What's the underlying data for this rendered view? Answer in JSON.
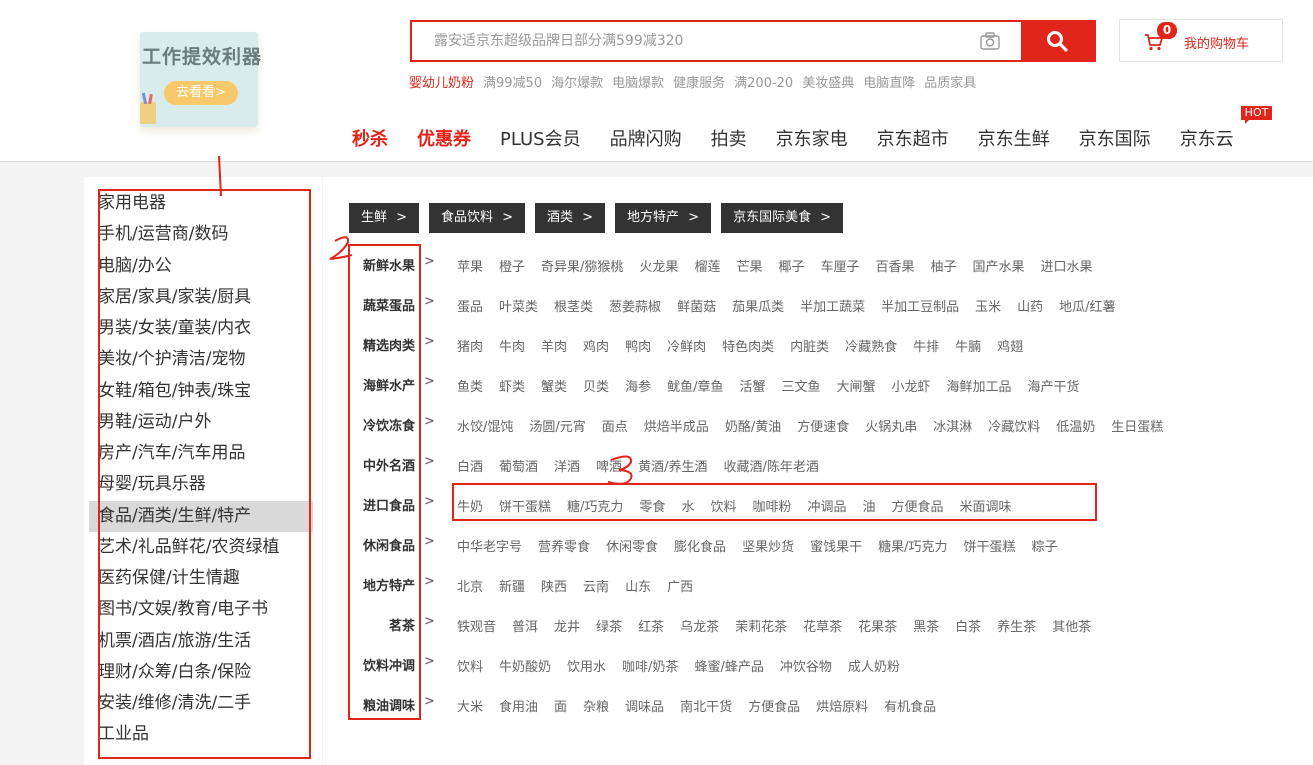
{
  "promo": {
    "title": "工作提效利器",
    "button": "去看看>"
  },
  "search": {
    "placeholder": "露安适京东超级品牌日部分满599减320"
  },
  "cart": {
    "count": "0",
    "label": "我的购物车"
  },
  "hotwords": [
    "婴幼儿奶粉",
    "满99减50",
    "海尔爆款",
    "电脑爆款",
    "健康服务",
    "满200-20",
    "美妆盛典",
    "电脑直降",
    "品质家具"
  ],
  "nav": {
    "items": [
      "秒杀",
      "优惠券",
      "PLUS会员",
      "品牌闪购",
      "拍卖",
      "京东家电",
      "京东超市",
      "京东生鲜",
      "京东国际",
      "京东云"
    ],
    "hot_badge": "HOT"
  },
  "categories": [
    "家用电器",
    "手机/运营商/数码",
    "电脑/办公",
    "家居/家具/家装/厨具",
    "男装/女装/童装/内衣",
    "美妆/个护清洁/宠物",
    "女鞋/箱包/钟表/珠宝",
    "男鞋/运动/户外",
    "房产/汽车/汽车用品",
    "母婴/玩具乐器",
    "食品/酒类/生鲜/特产",
    "艺术/礼品鲜花/农资绿植",
    "医药保健/计生情趣",
    "图书/文娱/教育/电子书",
    "机票/酒店/旅游/生活",
    "理财/众筹/白条/保险",
    "安装/维修/清洗/二手",
    "工业品"
  ],
  "active_category_index": 10,
  "channel_tabs": [
    "生鲜",
    "食品饮料",
    "酒类",
    "地方特产",
    "京东国际美食"
  ],
  "chevron_glyph": ">",
  "subcategories": [
    {
      "title": "新鲜水果",
      "items": [
        "苹果",
        "橙子",
        "奇异果/猕猴桃",
        "火龙果",
        "榴莲",
        "芒果",
        "椰子",
        "车厘子",
        "百香果",
        "柚子",
        "国产水果",
        "进口水果"
      ]
    },
    {
      "title": "蔬菜蛋品",
      "items": [
        "蛋品",
        "叶菜类",
        "根茎类",
        "葱姜蒜椒",
        "鲜菌菇",
        "茄果瓜类",
        "半加工蔬菜",
        "半加工豆制品",
        "玉米",
        "山药",
        "地瓜/红薯"
      ]
    },
    {
      "title": "精选肉类",
      "items": [
        "猪肉",
        "牛肉",
        "羊肉",
        "鸡肉",
        "鸭肉",
        "冷鲜肉",
        "特色肉类",
        "内脏类",
        "冷藏熟食",
        "牛排",
        "牛腩",
        "鸡翅"
      ]
    },
    {
      "title": "海鲜水产",
      "items": [
        "鱼类",
        "虾类",
        "蟹类",
        "贝类",
        "海参",
        "鱿鱼/章鱼",
        "活蟹",
        "三文鱼",
        "大闸蟹",
        "小龙虾",
        "海鲜加工品",
        "海产干货"
      ]
    },
    {
      "title": "冷饮冻食",
      "items": [
        "水饺/馄饨",
        "汤圆/元宵",
        "面点",
        "烘焙半成品",
        "奶酪/黄油",
        "方便速食",
        "火锅丸串",
        "冰淇淋",
        "冷藏饮料",
        "低温奶",
        "生日蛋糕"
      ]
    },
    {
      "title": "中外名酒",
      "items": [
        "白酒",
        "葡萄酒",
        "洋酒",
        "啤酒",
        "黄酒/养生酒",
        "收藏酒/陈年老酒"
      ]
    },
    {
      "title": "进口食品",
      "items": [
        "牛奶",
        "饼干蛋糕",
        "糖/巧克力",
        "零食",
        "水",
        "饮料",
        "咖啡粉",
        "冲调品",
        "油",
        "方便食品",
        "米面调味"
      ]
    },
    {
      "title": "休闲食品",
      "items": [
        "中华老字号",
        "营养零食",
        "休闲零食",
        "膨化食品",
        "坚果炒货",
        "蜜饯果干",
        "糖果/巧克力",
        "饼干蛋糕",
        "粽子"
      ]
    },
    {
      "title": "地方特产",
      "items": [
        "北京",
        "新疆",
        "陕西",
        "云南",
        "山东",
        "广西"
      ]
    },
    {
      "title": "茗茶",
      "items": [
        "铁观音",
        "普洱",
        "龙井",
        "绿茶",
        "红茶",
        "乌龙茶",
        "茉莉花茶",
        "花草茶",
        "花果茶",
        "黑茶",
        "白茶",
        "养生茶",
        "其他茶"
      ]
    },
    {
      "title": "饮料冲调",
      "items": [
        "饮料",
        "牛奶酸奶",
        "饮用水",
        "咖啡/奶茶",
        "蜂蜜/蜂产品",
        "冲饮谷物",
        "成人奶粉"
      ]
    },
    {
      "title": "粮油调味",
      "items": [
        "大米",
        "食用油",
        "面",
        "杂粮",
        "调味品",
        "南北干货",
        "方便食品",
        "烘焙原料",
        "有机食品"
      ]
    }
  ],
  "colors": {
    "brand_red": "#e1251b",
    "tab_dark": "#333333",
    "active_row": "#d9d9d9"
  }
}
